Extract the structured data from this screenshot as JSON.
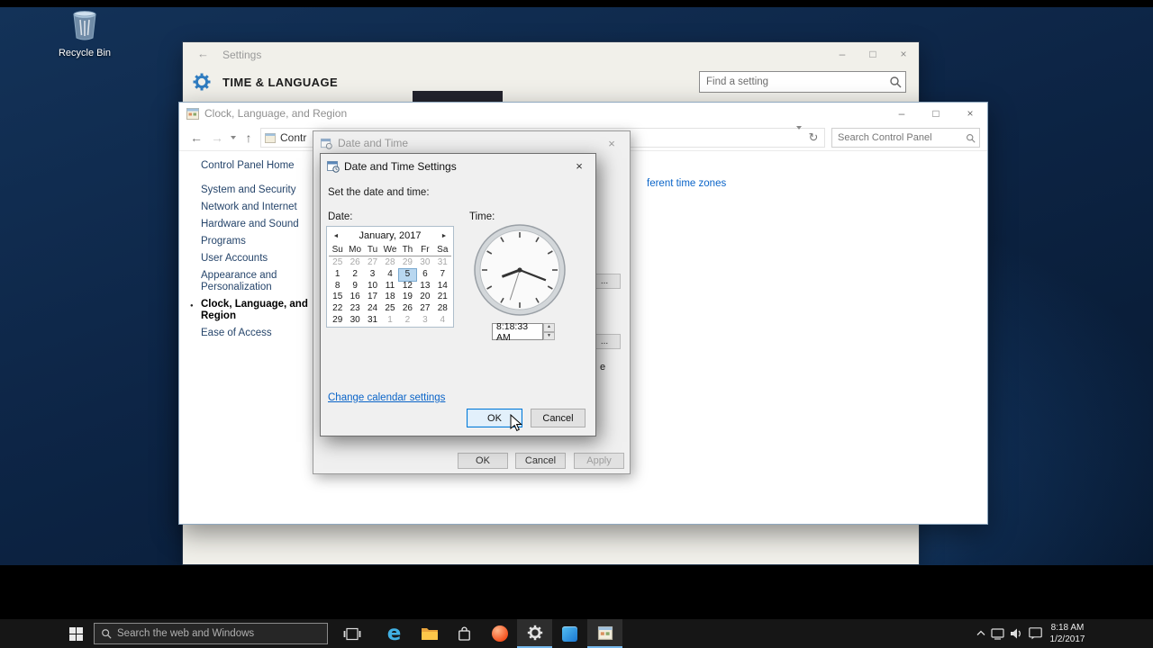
{
  "glyphs": {
    "minimize": "–",
    "maximize": "□",
    "close": "×",
    "back": "←",
    "forward": "→",
    "up": "↑",
    "refresh": "↻",
    "prev": "◄",
    "next": "►",
    "spin_up": "▲",
    "spin_down": "▼",
    "bullet": "●",
    "edge": "e"
  },
  "desktop": {
    "recycle_bin_label": "Recycle Bin"
  },
  "settings_window": {
    "title": "Settings",
    "page_title": "TIME & LANGUAGE",
    "search_placeholder": "Find a setting"
  },
  "control_panel": {
    "title": "Clock, Language, and Region",
    "breadcrumb": "Contr",
    "search_placeholder": "Search Control Panel",
    "sidebar_items": [
      {
        "label": "Control Panel Home",
        "home": true
      },
      {
        "label": "System and Security"
      },
      {
        "label": "Network and Internet"
      },
      {
        "label": "Hardware and Sound"
      },
      {
        "label": "Programs"
      },
      {
        "label": "User Accounts"
      },
      {
        "label": "Appearance and Personalization"
      },
      {
        "label": "Clock, Language, and Region",
        "active": true
      },
      {
        "label": "Ease of Access"
      }
    ],
    "content_link_fragment": "ferent time zones"
  },
  "date_time_dialog": {
    "title": "Date and Time",
    "button_fragment": "...",
    "text_fragment": "e",
    "ok": "OK",
    "cancel": "Cancel",
    "apply": "Apply"
  },
  "date_time_settings": {
    "title": "Date and Time Settings",
    "instruction": "Set the date and time:",
    "date_label": "Date:",
    "time_label": "Time:",
    "month_label": "January, 2017",
    "calendar": {
      "day_headers": [
        "Su",
        "Mo",
        "Tu",
        "We",
        "Th",
        "Fr",
        "Sa"
      ],
      "weeks": [
        [
          {
            "d": 25,
            "muted": true
          },
          {
            "d": 26,
            "muted": true
          },
          {
            "d": 27,
            "muted": true
          },
          {
            "d": 28,
            "muted": true
          },
          {
            "d": 29,
            "muted": true
          },
          {
            "d": 30,
            "muted": true
          },
          {
            "d": 31,
            "muted": true
          }
        ],
        [
          {
            "d": 1
          },
          {
            "d": 2
          },
          {
            "d": 3
          },
          {
            "d": 4
          },
          {
            "d": 5,
            "selected": true
          },
          {
            "d": 6
          },
          {
            "d": 7
          }
        ],
        [
          {
            "d": 8
          },
          {
            "d": 9
          },
          {
            "d": 10
          },
          {
            "d": 11
          },
          {
            "d": 12
          },
          {
            "d": 13
          },
          {
            "d": 14
          }
        ],
        [
          {
            "d": 15
          },
          {
            "d": 16
          },
          {
            "d": 17
          },
          {
            "d": 18
          },
          {
            "d": 19
          },
          {
            "d": 20
          },
          {
            "d": 21
          }
        ],
        [
          {
            "d": 22
          },
          {
            "d": 23
          },
          {
            "d": 24
          },
          {
            "d": 25
          },
          {
            "d": 26
          },
          {
            "d": 27
          },
          {
            "d": 28
          }
        ],
        [
          {
            "d": 29
          },
          {
            "d": 30
          },
          {
            "d": 31
          },
          {
            "d": 1,
            "muted": true
          },
          {
            "d": 2,
            "muted": true
          },
          {
            "d": 3,
            "muted": true
          },
          {
            "d": 4,
            "muted": true
          }
        ]
      ]
    },
    "time_value": "8:18:33 AM",
    "link": "Change calendar settings",
    "ok": "OK",
    "cancel": "Cancel"
  },
  "taskbar": {
    "search_placeholder": "Search the web and Windows",
    "time": "8:18 AM",
    "date": "1/2/2017"
  }
}
